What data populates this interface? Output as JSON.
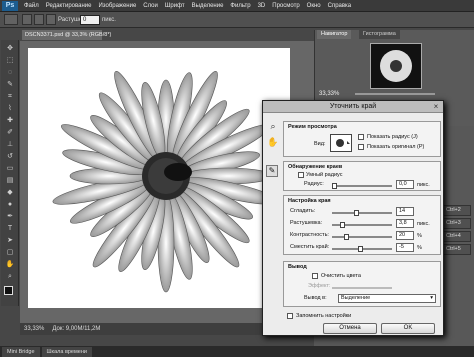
{
  "app": {
    "logo": "Ps"
  },
  "menu": [
    "Файл",
    "Редактирование",
    "Изображение",
    "Слои",
    "Шрифт",
    "Выделение",
    "Фильтр",
    "3D",
    "Просмотр",
    "Окно",
    "Справка"
  ],
  "options_bar": {
    "feather_label": "Растушевка:",
    "feather_value": "0",
    "feather_unit": "пикс."
  },
  "document": {
    "tab_title": "DSCN3371.psd @ 33,3% (RGB/8*)",
    "zoom": "33,33%",
    "doc_info": "Док: 9,00M/11,2M"
  },
  "bottom_tabs": [
    "Mini Bridge",
    "Шкала времени"
  ],
  "navigator": {
    "tabs": [
      "Навигатор",
      "Гистограмма"
    ],
    "zoom": "33,33%"
  },
  "actions": [
    "Ctrl+2",
    "Ctrl+3",
    "Ctrl+4",
    "Ctrl+5"
  ],
  "dialog": {
    "title": "Уточнить край",
    "view_mode": {
      "title": "Режим просмотра",
      "view_label": "Вид:",
      "show_radius": "Показать радиус (J)",
      "show_original": "Показать оригинал (P)"
    },
    "edge_detection": {
      "title": "Обнаружение краев",
      "smart_radius": "Умный радиус",
      "radius_label": "Радиус:",
      "radius_value": "0,0",
      "radius_unit": "пикс."
    },
    "adjust_edge": {
      "title": "Настройка края",
      "rows": [
        {
          "label": "Сгладить:",
          "value": "14",
          "unit": ""
        },
        {
          "label": "Растушевка:",
          "value": "3,8",
          "unit": "пикс."
        },
        {
          "label": "Контрастность:",
          "value": "20",
          "unit": "%"
        },
        {
          "label": "Сместить край:",
          "value": "-5",
          "unit": "%"
        }
      ]
    },
    "output": {
      "title": "Вывод",
      "decontaminate": "Очистить цвета",
      "amount_label": "Эффект:",
      "output_to_label": "Вывод в:",
      "output_to_value": "Выделение"
    },
    "remember": "Запомнить настройки",
    "cancel": "Отмена",
    "ok": "OK"
  }
}
